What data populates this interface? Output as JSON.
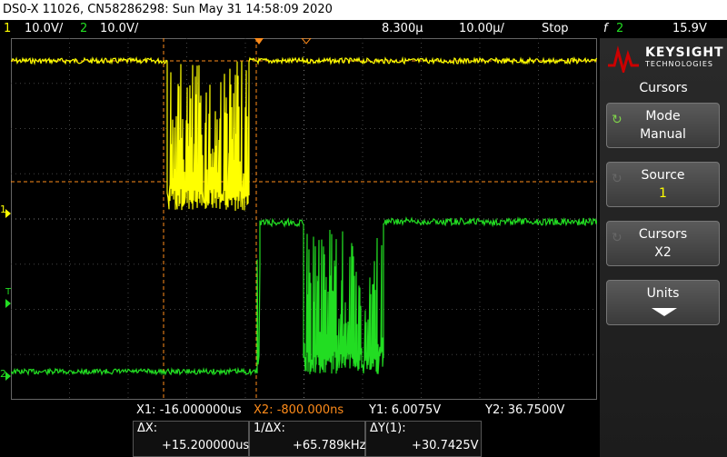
{
  "title": "DS0-X 11026, CN58286298: Sun May 31 14:58:09 2020",
  "status": {
    "ch1_num": "1",
    "ch1_scale": "10.0V/",
    "ch2_num": "2",
    "ch2_scale": "10.0V/",
    "time_offset": "8.300µ",
    "time_scale": "10.00µ/",
    "run_state": "Stop",
    "trig_symbol": "f",
    "trig_ch": "2",
    "trig_level": "15.9V"
  },
  "colors": {
    "ch1": "#ffff00",
    "ch2": "#22dd22",
    "cursor": "#ff8c1a",
    "brand": "#cc0000"
  },
  "markers": {
    "ch1": "1",
    "ch2": "2",
    "trig": "T"
  },
  "brand": {
    "name": "KEYSIGHT",
    "sub": "TECHNOLOGIES"
  },
  "side_panel": {
    "header": "Cursors",
    "buttons": [
      {
        "label": "Mode",
        "value": "Manual",
        "icon": "rotate-icon"
      },
      {
        "label": "Source",
        "value": "1",
        "icon": "rotate-icon"
      },
      {
        "label": "Cursors",
        "value": "X2",
        "icon": "rotate-icon"
      },
      {
        "label": "Units",
        "value": "",
        "icon": "down-arrow-icon"
      }
    ]
  },
  "readouts": {
    "x1": "X1: -16.000000us",
    "x2": "X2: -800.000ns",
    "y1": "Y1:  6.0075V",
    "y2": "Y2:  36.7500V",
    "dx_label": "ΔX:",
    "dx_value": "+15.200000us",
    "inv_dx_label": "1/ΔX:",
    "inv_dx_value": "+65.789kHz",
    "dy_label": "ΔY(1):",
    "dy_value": "+30.7425V"
  }
}
